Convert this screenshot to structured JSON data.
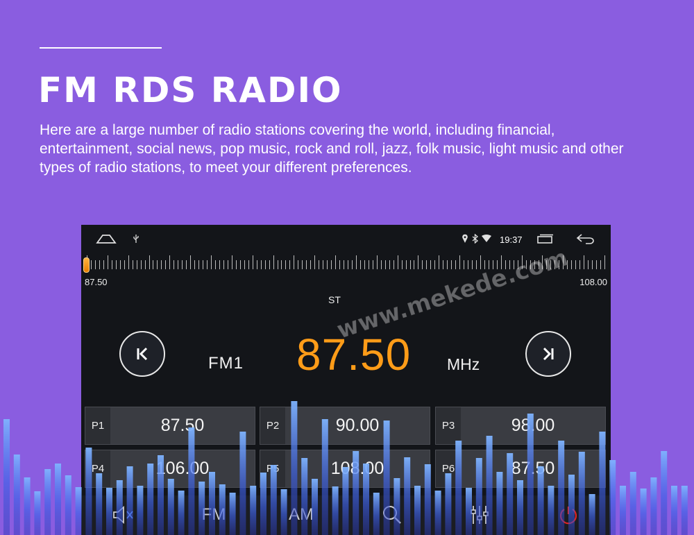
{
  "header": {
    "title": "FM RDS RADIO",
    "description": "Here are a large number of radio stations covering the world, including financial, entertainment, social news, pop music, rock and roll, jazz, folk music, light music and other types of radio stations, to meet your different preferences."
  },
  "statusbar": {
    "time": "19:37",
    "icons": [
      "home-icon",
      "usb-icon",
      "location-icon",
      "bluetooth-icon",
      "wifi-icon",
      "recents-icon",
      "back-icon"
    ]
  },
  "tuner": {
    "range_min": "87.50",
    "range_max": "108.00",
    "stereo": "ST",
    "band": "FM1",
    "frequency": "87.50",
    "unit": "MHz",
    "accent_color": "#ff9c18"
  },
  "presets": [
    {
      "label": "P1",
      "frequency": "87.50"
    },
    {
      "label": "P2",
      "frequency": "90.00"
    },
    {
      "label": "P3",
      "frequency": "98.00"
    },
    {
      "label": "P4",
      "frequency": "106.00"
    },
    {
      "label": "P5",
      "frequency": "108.00"
    },
    {
      "label": "P6",
      "frequency": "87.50"
    }
  ],
  "bottombar": {
    "fm_label": "FM",
    "am_label": "AM",
    "icons": [
      "mute-icon",
      "search-icon",
      "equalizer-icon",
      "power-icon"
    ]
  },
  "watermark": "www.mekede.com",
  "colors": {
    "background": "#8a5de0",
    "screen": "#131519",
    "power": "#e02424"
  }
}
